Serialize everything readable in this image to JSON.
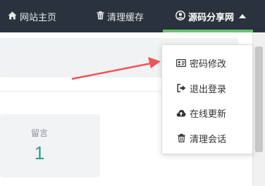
{
  "navbar": {
    "home_label": "网站主页",
    "cache_label": "清理缓存",
    "user_label": "源码分享网",
    "icons": {
      "home": "home-icon",
      "cache": "trash-icon",
      "user": "user-circle-icon",
      "caret": "caret-up-icon"
    },
    "accent_color": "#6cc070"
  },
  "dropdown": {
    "items": [
      {
        "label": "密码修改",
        "icon": "id-card-icon"
      },
      {
        "label": "退出登录",
        "icon": "sign-out-icon"
      },
      {
        "label": "在线更新",
        "icon": "cloud-upload-icon"
      },
      {
        "label": "清理会话",
        "icon": "trash-icon"
      }
    ]
  },
  "stats": {
    "card": {
      "label": "留言",
      "value": "1"
    }
  },
  "annotation": {
    "arrow_color": "#f05454"
  }
}
